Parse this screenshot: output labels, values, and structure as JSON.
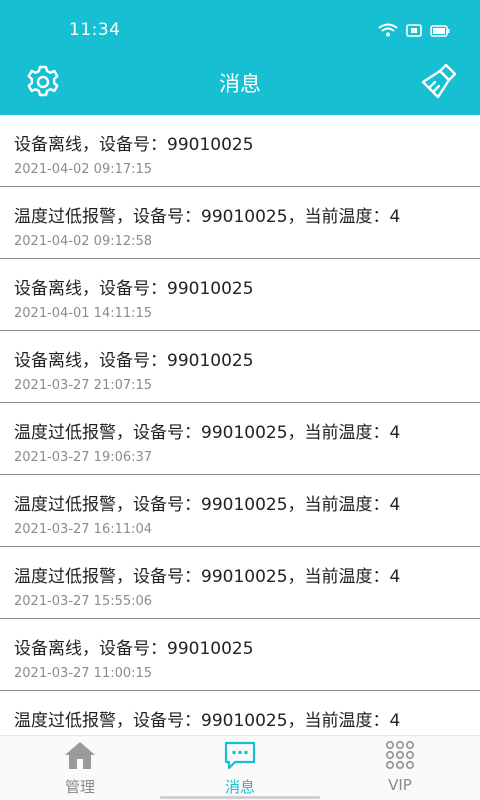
{
  "status_bar": {
    "time": "11:34"
  },
  "header": {
    "title": "消息"
  },
  "messages": [
    {
      "text": "设备离线，设备号：99010025",
      "time": "2021-04-02 09:17:15"
    },
    {
      "text": "温度过低报警，设备号：99010025，当前温度：4",
      "time": "2021-04-02 09:12:58"
    },
    {
      "text": "设备离线，设备号：99010025",
      "time": "2021-04-01 14:11:15"
    },
    {
      "text": "设备离线，设备号：99010025",
      "time": "2021-03-27 21:07:15"
    },
    {
      "text": "温度过低报警，设备号：99010025，当前温度：4",
      "time": "2021-03-27 19:06:37"
    },
    {
      "text": "温度过低报警，设备号：99010025，当前温度：4",
      "time": "2021-03-27 16:11:04"
    },
    {
      "text": "温度过低报警，设备号：99010025，当前温度：4",
      "time": "2021-03-27 15:55:06"
    },
    {
      "text": "设备离线，设备号：99010025",
      "time": "2021-03-27 11:00:15"
    },
    {
      "text": "温度过低报警，设备号：99010025，当前温度：4",
      "time": ""
    }
  ],
  "tabbar": {
    "tabs": [
      {
        "label": "管理",
        "icon": "home-icon",
        "active": false
      },
      {
        "label": "消息",
        "icon": "message-icon",
        "active": true
      },
      {
        "label": "VIP",
        "icon": "grid-icon",
        "active": false
      }
    ]
  },
  "colors": {
    "accent": "#17bfd2",
    "divider": "#8e8e8e",
    "muted": "#8c8c8c"
  }
}
